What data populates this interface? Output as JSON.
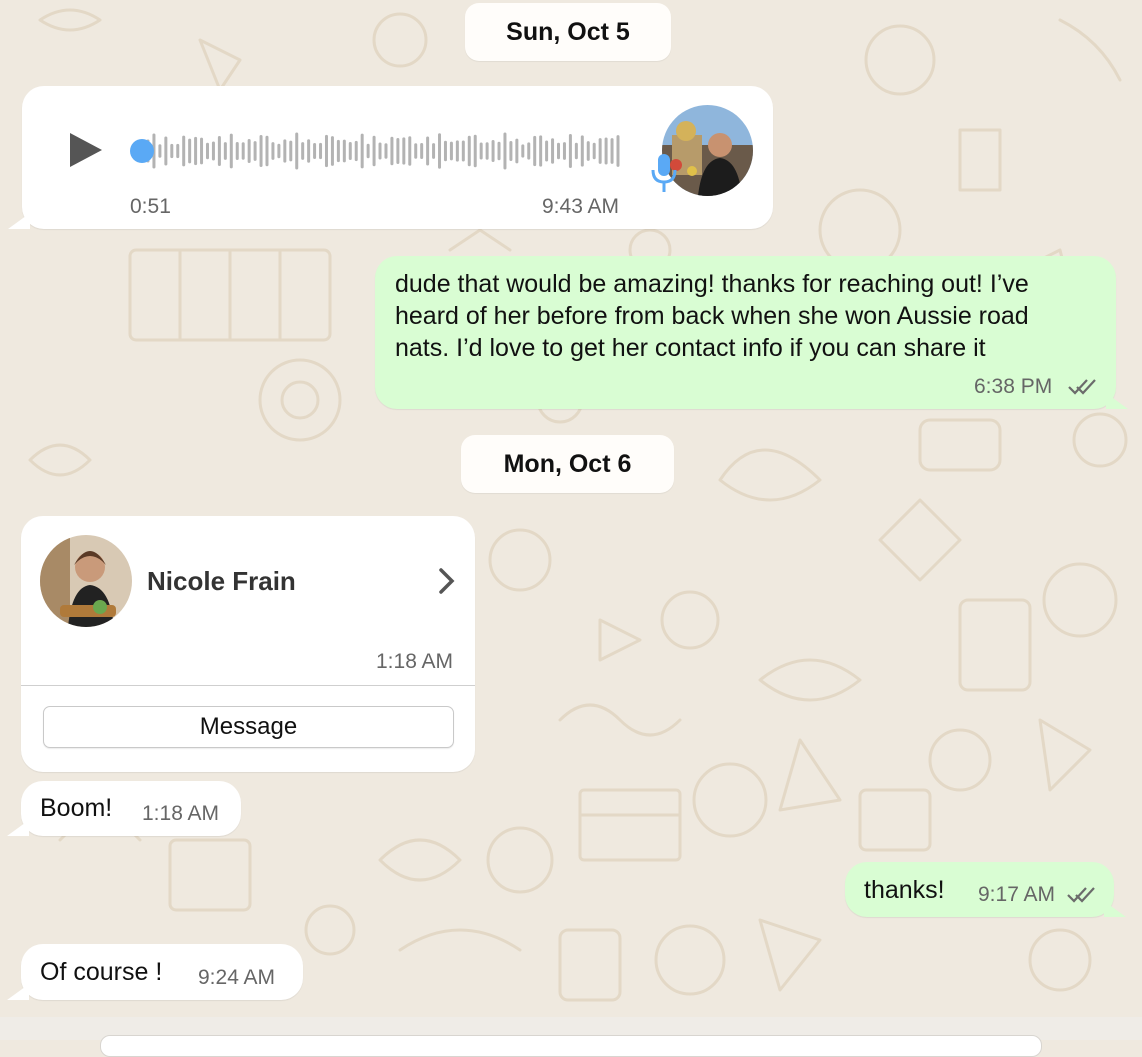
{
  "dates": [
    "Sun, Oct 5",
    "Mon, Oct 6"
  ],
  "voice_note": {
    "duration": "0:51",
    "time": "9:43 AM",
    "progress": 0,
    "play_icon": "play-icon",
    "mic_icon": "microphone-icon",
    "accent": "#5aa9f5"
  },
  "messages": [
    {
      "lines": [
        "dude that would be amazing! thanks for reaching out! I’ve",
        "heard of her before from back when she won Aussie road",
        "nats. I’d love to get her contact info if you can share it"
      ],
      "time": "6:38 PM",
      "status": "read"
    },
    {
      "text": "Boom!",
      "time": "1:18 AM"
    },
    {
      "text": "thanks!",
      "time": "9:17 AM",
      "status": "read"
    },
    {
      "text": "Of course !",
      "time": "9:24 AM"
    }
  ],
  "contact_card": {
    "name": "Nicole Frain",
    "time": "1:18 AM",
    "button_label": "Message",
    "chevron_icon": "chevron-right-icon"
  },
  "colors": {
    "wallpaper": "#efe9df",
    "incoming_bubble": "#ffffff",
    "outgoing_bubble": "#d9fdd3",
    "read_ticks": "#6b6b6b"
  }
}
